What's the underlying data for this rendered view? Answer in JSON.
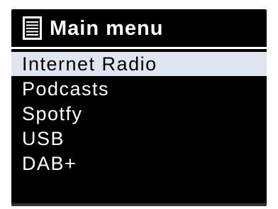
{
  "header": {
    "icon": "menu-list-icon",
    "title": "Main menu"
  },
  "menu": {
    "selected_index": 0,
    "items": [
      {
        "label": "Internet Radio"
      },
      {
        "label": "Podcasts"
      },
      {
        "label": "Spotfy"
      },
      {
        "label": "USB"
      },
      {
        "label": "DAB+"
      }
    ]
  },
  "colors": {
    "screen_background": "#000000",
    "text": "#ffffff",
    "selection_background": "#dde6f0",
    "selection_text": "#000000"
  }
}
